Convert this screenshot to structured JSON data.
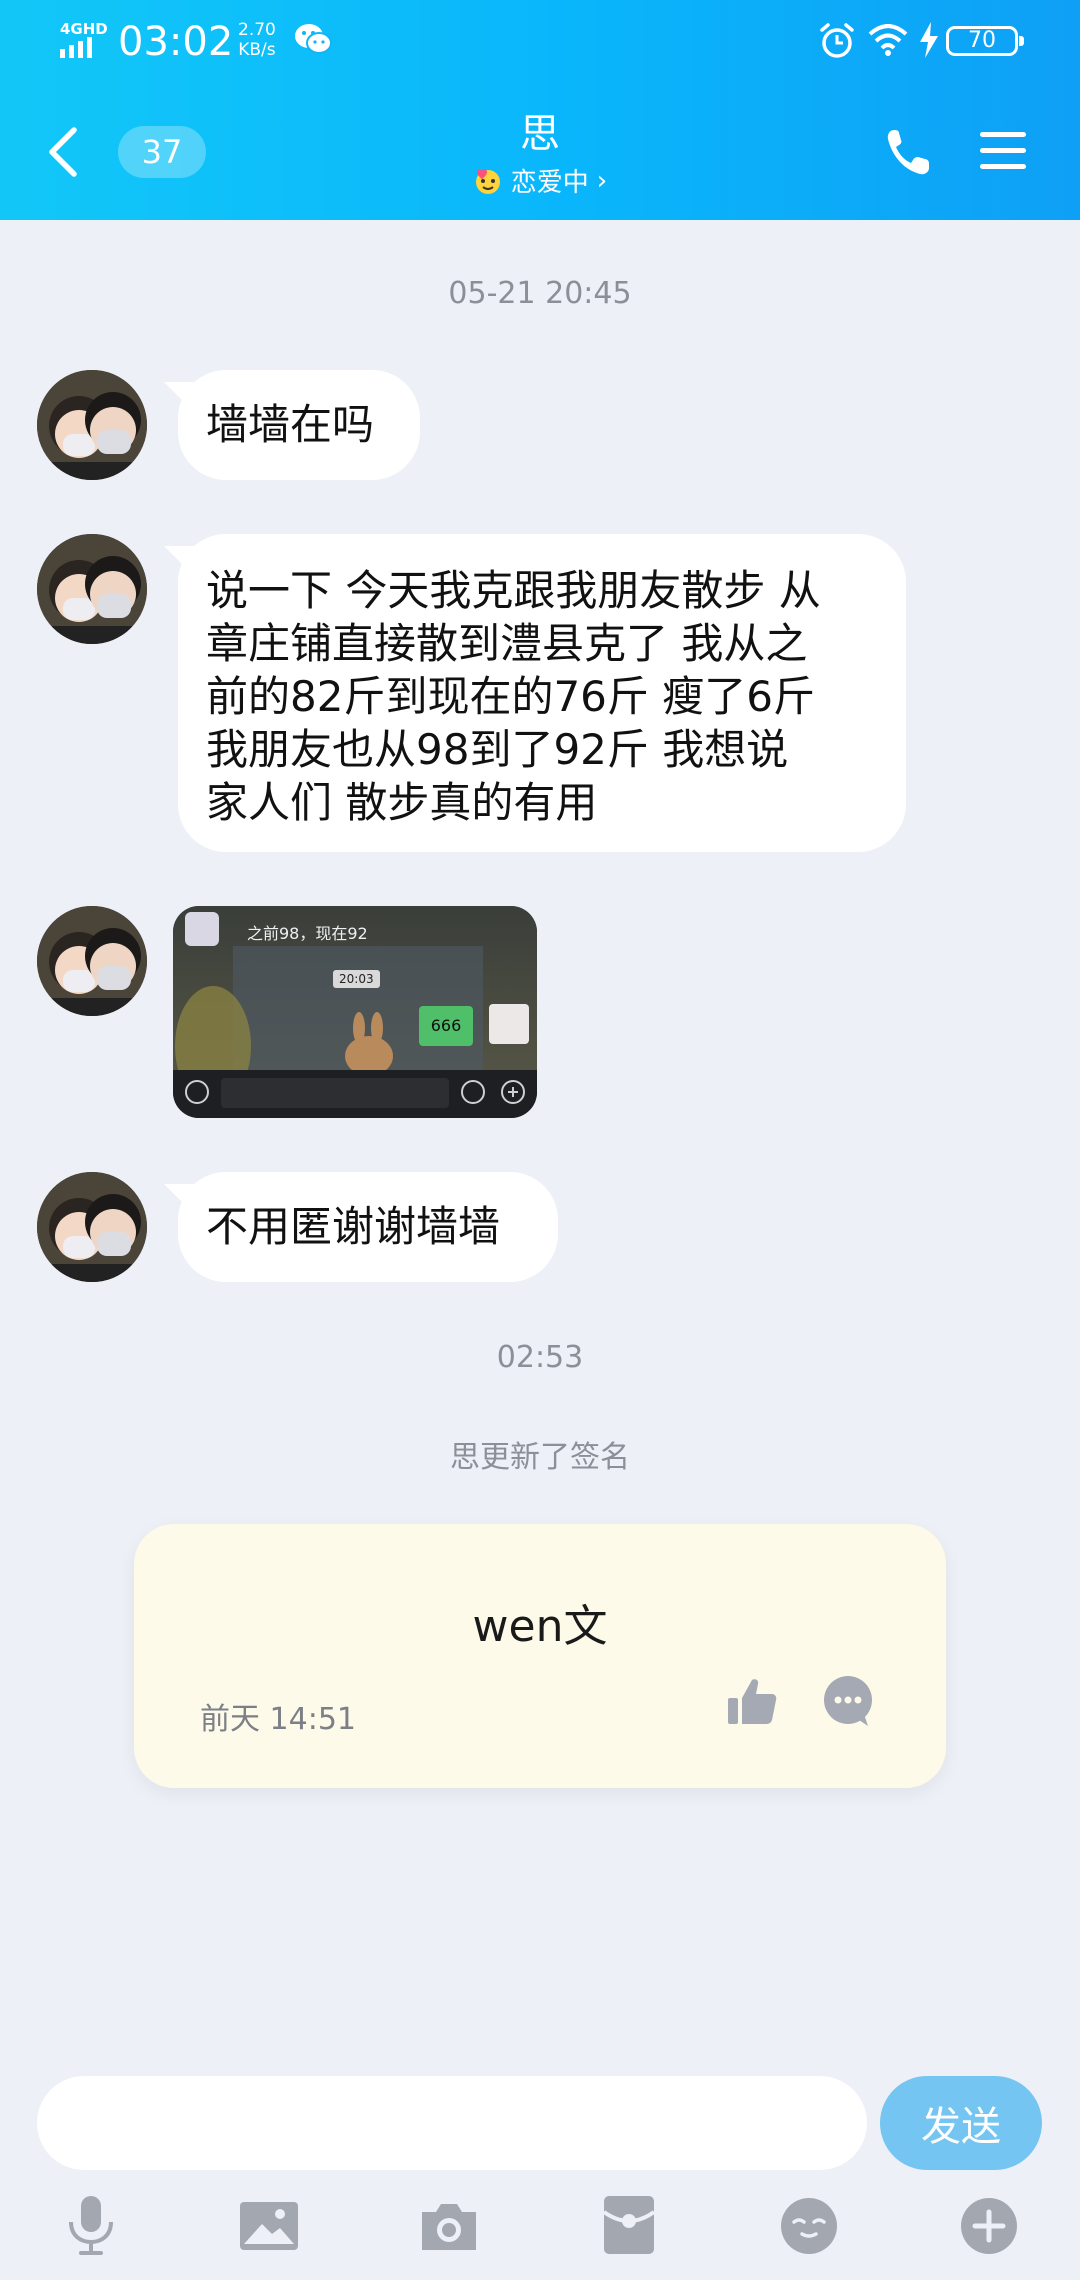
{
  "status_bar": {
    "network": "4GHD",
    "time": "03:02",
    "speed_value": "2.70",
    "speed_unit": "KB/s",
    "battery": "70"
  },
  "nav": {
    "unread_count": "37",
    "title": "思",
    "subtitle": "恋爱中",
    "subtitle_arrow": "›"
  },
  "chat": {
    "timestamp_1": "05-21 20:45",
    "messages": [
      {
        "lines": [
          "墙墙在吗"
        ]
      },
      {
        "lines": [
          "说一下 今天我克跟我朋友散步 从",
          "章庄铺直接散到澧县克了 我从之",
          "前的82斤到现在的76斤 瘦了6斤",
          "我朋友也从98到了92斤 我想说",
          "家人们 散步真的有用"
        ]
      },
      {
        "image_caption": "之前98，现在92",
        "image_time": "20:03",
        "image_reply": "666"
      },
      {
        "lines": [
          "不用匿谢谢墙墙"
        ]
      }
    ],
    "timestamp_2": "02:53",
    "system_note": "思更新了签名"
  },
  "signature_card": {
    "text": "wen文",
    "date": "前天 14:51"
  },
  "input": {
    "placeholder": "",
    "send_label": "发送"
  },
  "toolbar": {
    "icons": [
      "microphone-icon",
      "image-icon",
      "camera-icon",
      "red-packet-icon",
      "emoji-icon",
      "plus-icon"
    ]
  },
  "colors": {
    "header_start": "#12c7f8",
    "header_end": "#0ea0f6",
    "background": "#edf0f6",
    "bubble": "#ffffff",
    "send_button": "#74c5f2",
    "signature_card": "#fdfaea",
    "toolbar_icon": "#a3a7b0"
  }
}
